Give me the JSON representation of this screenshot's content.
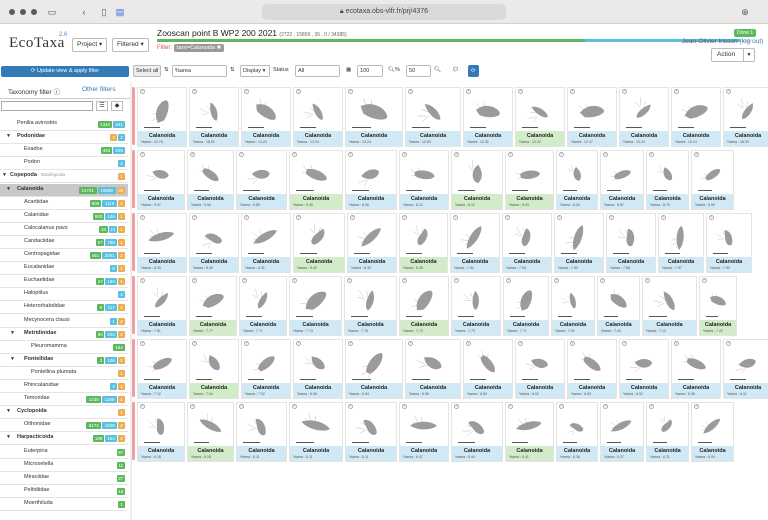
{
  "browser": {
    "url": "ecotaxa.obs-vlfr.fr/prj/4376"
  },
  "header": {
    "logo_text": "EcoTaxa",
    "version": "2.6",
    "project_button": "Project",
    "filtered_button": "Filtered",
    "project_title": "Zooscan point B WP2 200 2021",
    "project_stats": "(2722 , 15859 , 36 , 0 / 34385)",
    "filter_label": "Filter:",
    "filter_chip": "taxo=Calanoida ✖",
    "done_badge": "Done:1",
    "user_name": "Jean-Olivier Irisson",
    "logout_text": "(log out)",
    "action_label": "Action"
  },
  "toolbar": {
    "update_button": "Update view & apply filter",
    "select_all": "Select all",
    "sort_field": "%area",
    "display": "Display",
    "status_label": "Status",
    "status_value": "All",
    "page_size": "100",
    "zoom": "50"
  },
  "sidebar": {
    "tab_taxonomy": "Taxonomy filter",
    "tab_other": "Other filters",
    "rows": [
      {
        "name": "Penilia avirostris",
        "bold": false,
        "indent": 1,
        "tri": "",
        "badges": [
          "1342:g",
          "641:b"
        ]
      },
      {
        "name": "Podonidae",
        "bold": true,
        "indent": 1,
        "tri": "▼",
        "badges": [
          "3:o",
          "2:b"
        ]
      },
      {
        "name": "Evadne",
        "bold": false,
        "indent": 2,
        "tri": "",
        "badges": [
          "453:g",
          "238:b"
        ]
      },
      {
        "name": "Podon",
        "bold": false,
        "indent": 2,
        "tri": "",
        "badges": [
          "2:b"
        ]
      },
      {
        "name": "Copepoda",
        "sub": "Maxillopoda",
        "bold": true,
        "indent": 0,
        "tri": "▼",
        "badges": [
          "1:o"
        ]
      },
      {
        "name": "Calanoida",
        "bold": true,
        "indent": 1,
        "tri": "▼",
        "badges": [
          "12721:g",
          "10698:b",
          "36:o"
        ],
        "selected": true
      },
      {
        "name": "Acartiidae",
        "bold": false,
        "indent": 2,
        "tri": "",
        "badges": [
          "808:g",
          "1119:b",
          "3:o"
        ]
      },
      {
        "name": "Calanidae",
        "bold": false,
        "indent": 2,
        "tri": "",
        "badges": [
          "803:g",
          "146:b",
          "1:o"
        ]
      },
      {
        "name": "Calocalanus pavo",
        "bold": false,
        "indent": 2,
        "tri": "",
        "badges": [
          "18:g",
          "21:b",
          "1:o"
        ]
      },
      {
        "name": "Candaciidae",
        "bold": false,
        "indent": 2,
        "tri": "",
        "badges": [
          "67:g",
          "756:b",
          "1:o"
        ]
      },
      {
        "name": "Centropagidae",
        "bold": false,
        "indent": 2,
        "tri": "",
        "badges": [
          "451:g",
          "2061:b",
          "2:o"
        ]
      },
      {
        "name": "Eucalanidae",
        "bold": false,
        "indent": 2,
        "tri": "",
        "badges": [
          "6:b",
          "1:o"
        ]
      },
      {
        "name": "Euchaetidae",
        "bold": false,
        "indent": 2,
        "tri": "",
        "badges": [
          "27:g",
          "194:b",
          "1:o"
        ]
      },
      {
        "name": "Haloptilus",
        "bold": false,
        "indent": 2,
        "tri": "",
        "badges": [
          "4:b"
        ]
      },
      {
        "name": "Heterorhabdidae",
        "bold": false,
        "indent": 2,
        "tri": "",
        "badges": [
          "5:g",
          "117:b",
          "2:o"
        ]
      },
      {
        "name": "Mecynocera clausi",
        "bold": false,
        "indent": 2,
        "tri": "",
        "badges": [
          "1:b",
          "2:o"
        ]
      },
      {
        "name": "Metridinidae",
        "bold": true,
        "indent": 2,
        "tri": "▼",
        "badges": [
          "60:g",
          "233:b",
          "2:o"
        ]
      },
      {
        "name": "Pleuromamma",
        "bold": false,
        "indent": 3,
        "tri": "",
        "badges": [
          "184:g"
        ]
      },
      {
        "name": "Pontellidae",
        "bold": true,
        "indent": 2,
        "tri": "▼",
        "badges": [
          "3:g",
          "106:b",
          "2:o"
        ]
      },
      {
        "name": "Pontellina plumata",
        "bold": false,
        "indent": 3,
        "tri": "",
        "badges": [
          "1:o"
        ]
      },
      {
        "name": "Rhincalanidae",
        "bold": false,
        "indent": 2,
        "tri": "",
        "badges": [
          "3:b",
          "2:o"
        ]
      },
      {
        "name": "Temoridae",
        "bold": false,
        "indent": 2,
        "tri": "",
        "badges": [
          "1230:g",
          "1186:b",
          "1:o"
        ]
      },
      {
        "name": "Cyclopoida",
        "bold": true,
        "indent": 1,
        "tri": "▼",
        "badges": [
          "1:o"
        ]
      },
      {
        "name": "Oithonidae",
        "bold": false,
        "indent": 2,
        "tri": "",
        "badges": [
          "6172:g",
          "1929:b",
          "2:o"
        ]
      },
      {
        "name": "Harpacticoida",
        "bold": true,
        "indent": 1,
        "tri": "▼",
        "badges": [
          "188:g",
          "154:b",
          "2:o"
        ]
      },
      {
        "name": "Euterpina",
        "bold": false,
        "indent": 2,
        "tri": "",
        "badges": [
          "87:g"
        ]
      },
      {
        "name": "Microsetella",
        "bold": false,
        "indent": 2,
        "tri": "",
        "badges": [
          "11:g"
        ]
      },
      {
        "name": "Miraciidae",
        "bold": false,
        "indent": 2,
        "tri": "",
        "badges": [
          "27:g"
        ]
      },
      {
        "name": "Peltidiidae",
        "bold": false,
        "indent": 2,
        "tri": "",
        "badges": [
          "15:g"
        ]
      },
      {
        "name": "Moerthiluda",
        "bold": false,
        "indent": 2,
        "tri": "",
        "badges": [
          "1:g"
        ]
      }
    ]
  },
  "gallery": {
    "label": "Calanoida",
    "rows": [
      {
        "widths": [
          50,
          50,
          50,
          50,
          58,
          56,
          50,
          50,
          50,
          50,
          50,
          50
        ],
        "areas": [
          "%area : 22.75",
          "%area : 18.01",
          "%area : 14.23",
          "%area : 13.04",
          "%area : 13.24",
          "%area : 12.84",
          "%area : 12.31",
          "%area : 12.22",
          "%area : 12.47",
          "%area : 10.24",
          "%area : 10.14",
          "%area : 18.09"
        ],
        "green": [
          7
        ]
      },
      {
        "widths": [
          48,
          47,
          51,
          54,
          52,
          50,
          52,
          49,
          42,
          44,
          43,
          43
        ],
        "areas": [
          "%area : 9.97",
          "%area : 9.06",
          "%area : 9.83",
          "%area : 9.40",
          "%area : 8.06",
          "%area : 8.12",
          "%area : 8.12",
          "%area : 8.03",
          "%area : 8.04",
          "%area : 8.87",
          "%area : 8.79",
          "%area : 8.59"
        ],
        "green": [
          3,
          6,
          7
        ]
      },
      {
        "widths": [
          50,
          50,
          50,
          52,
          50,
          49,
          50,
          50,
          50,
          50,
          46,
          46
        ],
        "areas": [
          "%area : 8.30",
          "%area : 8.30",
          "%area : 8.31",
          "%area : 8.42",
          "%area : 8.33",
          "%area : 8.28",
          "%area : 7.94",
          "%area : 7.93",
          "%area : 7.53",
          "%area : 7.88",
          "%area : 7.97",
          "%area : 7.93"
        ],
        "green": [
          3,
          5
        ]
      },
      {
        "widths": [
          50,
          48,
          48,
          53,
          53,
          50,
          50,
          46,
          44,
          43,
          55,
          38
        ],
        "areas": [
          "%area : 7.81",
          "%area : 7.77",
          "%area : 7.71",
          "%area : 7.74",
          "%area : 7.78",
          "%area : 7.73",
          "%area : 7.70",
          "%area : 7.71",
          "%area : 7.51",
          "%area : 7.43",
          "%area : 7.12",
          "%area : 7.22"
        ],
        "green": [
          1,
          5,
          11
        ]
      },
      {
        "widths": [
          50,
          50,
          50,
          50,
          58,
          56,
          50,
          50,
          50,
          50,
          50,
          50
        ],
        "areas": [
          "%area : 7.12",
          "%area : 7.04",
          "%area : 7.02",
          "%area : 6.08",
          "%area : 6.94",
          "%area : 6.98",
          "%area : 6.84",
          "%area : 6.02",
          "%area : 6.63",
          "%area : 6.52",
          "%area : 6.46",
          "%area : 6.11"
        ],
        "green": [
          1
        ]
      },
      {
        "widths": [
          48,
          47,
          51,
          54,
          52,
          50,
          52,
          49,
          42,
          44,
          43,
          43
        ],
        "areas": [
          "%area : 6.18",
          "%area : 6.18",
          "%area : 6.11",
          "%area : 6.11",
          "%area : 6.11",
          "%area : 6.47",
          "%area : 6.44",
          "%area : 6.41",
          "%area : 6.36",
          "%area : 6.27",
          "%area : 6.21",
          "%area : 6.04"
        ],
        "green": [
          1,
          7
        ]
      }
    ]
  }
}
